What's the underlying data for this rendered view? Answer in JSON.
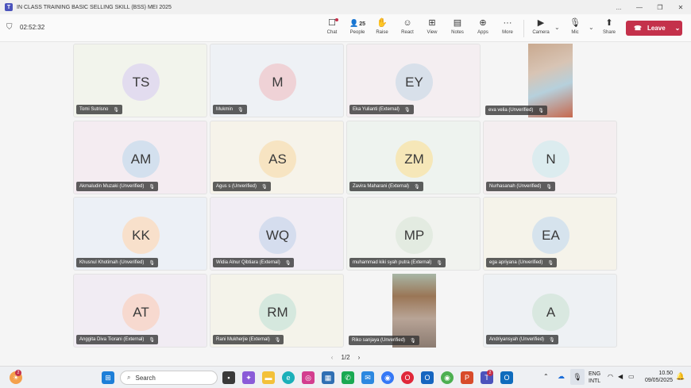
{
  "window": {
    "app_icon": "T",
    "title": "IN CLASS TRAINING BASIC SELLING SKILL (BSS) MEI 2025",
    "controls": [
      "...",
      "—",
      "❐",
      "✕"
    ]
  },
  "toolbar": {
    "timer": "02:52:32",
    "buttons": [
      {
        "icon": "chat-icon",
        "glyph": "☐",
        "label": "Chat"
      },
      {
        "icon": "people-icon",
        "glyph": "👤",
        "count": "25",
        "label": "People"
      },
      {
        "icon": "raise-hand-icon",
        "glyph": "✋",
        "label": "Raise"
      },
      {
        "icon": "react-icon",
        "glyph": "☺",
        "label": "React"
      },
      {
        "icon": "view-icon",
        "glyph": "⊞",
        "label": "View"
      },
      {
        "icon": "notes-icon",
        "glyph": "▤",
        "label": "Notes"
      },
      {
        "icon": "apps-icon",
        "glyph": "⊕",
        "label": "Apps"
      },
      {
        "icon": "more-icon",
        "glyph": "···",
        "label": "More"
      },
      {
        "icon": "camera-icon",
        "glyph": "▶",
        "label": "Camera"
      },
      {
        "icon": "mic-icon",
        "glyph": "🎙",
        "label": "Mic"
      },
      {
        "icon": "share-icon",
        "glyph": "⬆",
        "label": "Share"
      }
    ],
    "leave_label": "Leave"
  },
  "participants": [
    {
      "name": "Tomi Sutrisno",
      "initials": "TS",
      "avatar_bg": "#e2dcef",
      "tile_bg": "#f2f4ec"
    },
    {
      "name": "Mukmin",
      "initials": "M",
      "avatar_bg": "#efd2d6",
      "tile_bg": "#eef1f5"
    },
    {
      "name": "Eka Yulianti (External)",
      "initials": "EY",
      "avatar_bg": "#d8e0ea",
      "tile_bg": "#f4eef1"
    },
    {
      "name": "eva velia (Unverified)",
      "initials": "",
      "avatar_bg": "",
      "tile_bg": "#f5f5f5",
      "video": true
    },
    {
      "name": "Akmaludin Muzaki (Unverified)",
      "initials": "AM",
      "avatar_bg": "#d3e0ee",
      "tile_bg": "#f4ecf1"
    },
    {
      "name": "Agus s (Unverified)",
      "initials": "AS",
      "avatar_bg": "#f7e4c2",
      "tile_bg": "#f6f3ea"
    },
    {
      "name": "Zavira Maharani (External)",
      "initials": "ZM",
      "avatar_bg": "#f6e7b8",
      "tile_bg": "#eef3ef"
    },
    {
      "name": "Nurhasanah (Unverified)",
      "initials": "N",
      "avatar_bg": "#dcecef",
      "tile_bg": "#f4eef0"
    },
    {
      "name": "Khusnul Khotimah (Unverified)",
      "initials": "KK",
      "avatar_bg": "#f8e0cb",
      "tile_bg": "#ecf0f6"
    },
    {
      "name": "Widia Alnur Qibtiara (External)",
      "initials": "WQ",
      "avatar_bg": "#d5ddee",
      "tile_bg": "#f1edf4"
    },
    {
      "name": "muhammad kiki syah putra (External)",
      "initials": "MP",
      "avatar_bg": "#e3ebe1",
      "tile_bg": "#f1f3ef"
    },
    {
      "name": "ega apriyana (Unverified)",
      "initials": "EA",
      "avatar_bg": "#d6e3ed",
      "tile_bg": "#f5f3ea"
    },
    {
      "name": "Anggita Diva Tiorani (External)",
      "initials": "AT",
      "avatar_bg": "#f7d9cf",
      "tile_bg": "#f1ecf3"
    },
    {
      "name": "Rani Mukherjie (External)",
      "initials": "RM",
      "avatar_bg": "#d5e8de",
      "tile_bg": "#f4f3ea"
    },
    {
      "name": "Riko sanjaya (Unverified)",
      "initials": "",
      "avatar_bg": "",
      "tile_bg": "#f5f5f5",
      "video": true
    },
    {
      "name": "Andriyansyah (Unverified)",
      "initials": "A",
      "avatar_bg": "#d9e8e0",
      "tile_bg": "#eef1f4"
    }
  ],
  "pager": {
    "prev": "‹",
    "page": "1/2",
    "next": "›"
  },
  "taskbar": {
    "search_placeholder": "Search",
    "weather_badge": "2",
    "teams_badge": "2",
    "lang": "ENG",
    "layout": "INTL",
    "time": "10.50",
    "date": "09/05/2025"
  }
}
